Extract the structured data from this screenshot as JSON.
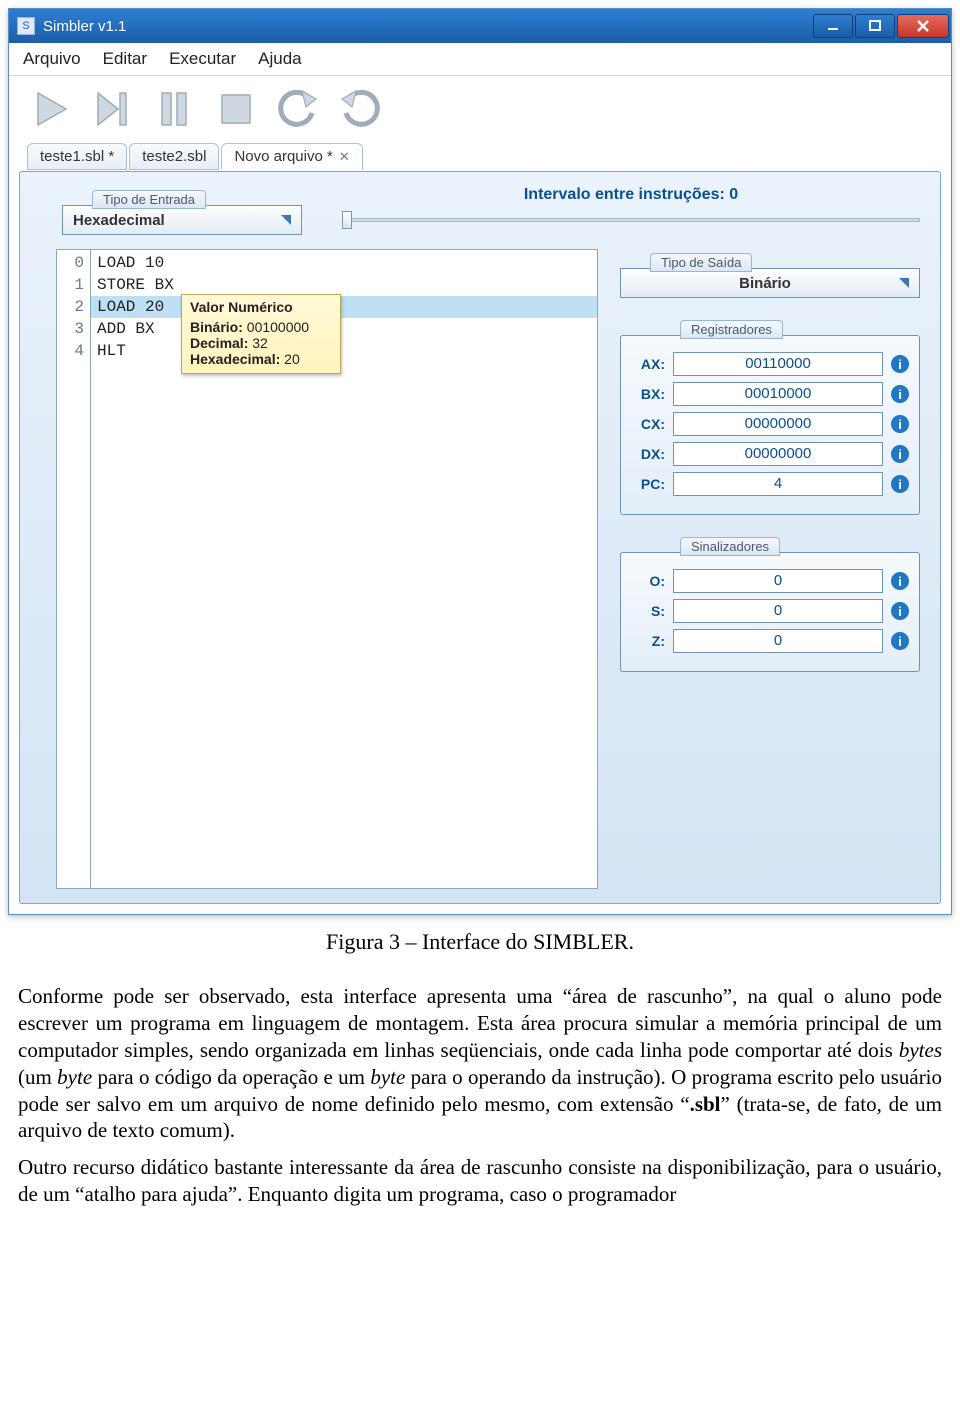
{
  "window": {
    "title": "Simbler v1.1",
    "icon_glyph": "S"
  },
  "menu": {
    "items": [
      "Arquivo",
      "Editar",
      "Executar",
      "Ajuda"
    ]
  },
  "toolbar_names": [
    "play-icon",
    "step-icon",
    "pause-icon",
    "stop-icon",
    "undo-icon",
    "redo-icon"
  ],
  "tabs": [
    {
      "label": "teste1.sbl *",
      "active": false,
      "closable": false
    },
    {
      "label": "teste2.sbl",
      "active": false,
      "closable": false
    },
    {
      "label": "Novo arquivo *",
      "active": true,
      "closable": true
    }
  ],
  "input_type": {
    "label": "Tipo de Entrada",
    "value": "Hexadecimal"
  },
  "interval": {
    "label": "Intervalo entre instruções: 0"
  },
  "output_type": {
    "label": "Tipo de Saída",
    "value": "Binário"
  },
  "code": {
    "lines": [
      {
        "n": "0",
        "text": "LOAD 10",
        "selected": false
      },
      {
        "n": "1",
        "text": "STORE BX",
        "selected": false
      },
      {
        "n": "2",
        "text": "LOAD 20",
        "selected": true
      },
      {
        "n": "3",
        "text": "ADD BX",
        "selected": false
      },
      {
        "n": "4",
        "text": "HLT",
        "selected": false
      }
    ]
  },
  "tooltip": {
    "title": "Valor Numérico",
    "rows": [
      {
        "k": "Binário:",
        "v": "00100000"
      },
      {
        "k": "Decimal:",
        "v": "32"
      },
      {
        "k": "Hexadecimal:",
        "v": "20"
      }
    ]
  },
  "registers": {
    "label": "Registradores",
    "rows": [
      {
        "name": "AX:",
        "value": "00110000"
      },
      {
        "name": "BX:",
        "value": "00010000"
      },
      {
        "name": "CX:",
        "value": "00000000"
      },
      {
        "name": "DX:",
        "value": "00000000"
      },
      {
        "name": "PC:",
        "value": "4"
      }
    ]
  },
  "flags": {
    "label": "Sinalizadores",
    "rows": [
      {
        "name": "O:",
        "value": "0"
      },
      {
        "name": "S:",
        "value": "0"
      },
      {
        "name": "Z:",
        "value": "0"
      }
    ]
  },
  "caption": "Figura 3 – Interface do SIMBLER.",
  "paragraphs": {
    "p1a": "Conforme pode ser observado, esta interface apresenta uma “área de rascunho”, na qual o aluno pode escrever um programa em linguagem de montagem. Esta área procura simular a memória principal de um computador simples, sendo organizada em linhas seqüenciais, onde cada linha pode comportar até dois ",
    "p1b": " (um ",
    "p1c": " para o código da operação e um ",
    "p1d": " para o operando da instrução). O programa escrito pelo usuário pode ser salvo em um arquivo de nome definido pelo mesmo, com extensão “",
    "p1e": "” (trata-se, de fato, de um arquivo de texto comum).",
    "bytes": "bytes",
    "byte": "byte",
    "sbl": ".sbl",
    "p2": "Outro recurso didático bastante interessante da área de rascunho consiste na disponibilização, para o usuário, de um “atalho para ajuda”. Enquanto digita um programa, caso o programador"
  }
}
